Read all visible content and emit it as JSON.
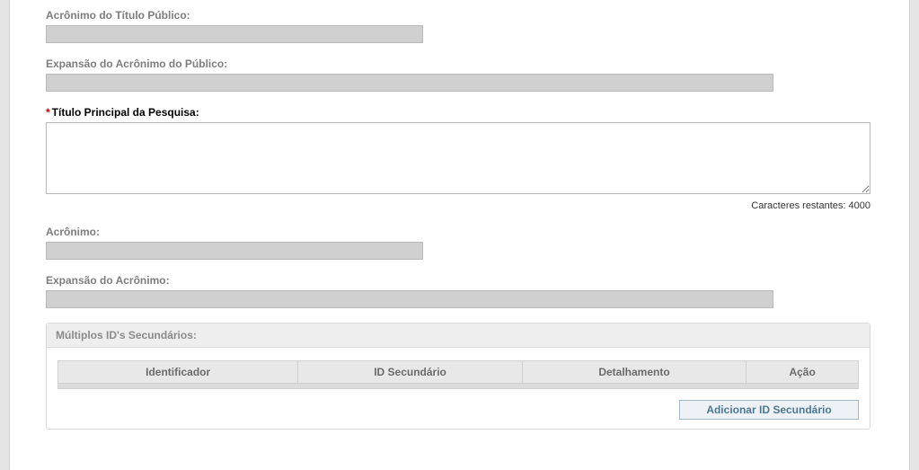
{
  "fields": {
    "acronimo_titulo_publico": {
      "label": "Acrônimo do Título Público:",
      "value": ""
    },
    "expansao_acronimo_publico": {
      "label": "Expansão do Acrônimo do Público:",
      "value": ""
    },
    "titulo_principal_pesquisa": {
      "label": "Título Principal da Pesquisa:",
      "value": "",
      "char_counter_label": "Caracteres restantes:",
      "char_remaining": "4000"
    },
    "acronimo": {
      "label": "Acrônimo:",
      "value": ""
    },
    "expansao_acronimo": {
      "label": "Expansão do Acrônimo:",
      "value": ""
    }
  },
  "secondary_ids": {
    "panel_title": "Múltiplos ID's Secundários:",
    "columns": {
      "identificador": "Identificador",
      "id_secundario": "ID Secundário",
      "detalhamento": "Detalhamento",
      "acao": "Ação"
    },
    "add_button": "Adicionar ID Secundário"
  }
}
